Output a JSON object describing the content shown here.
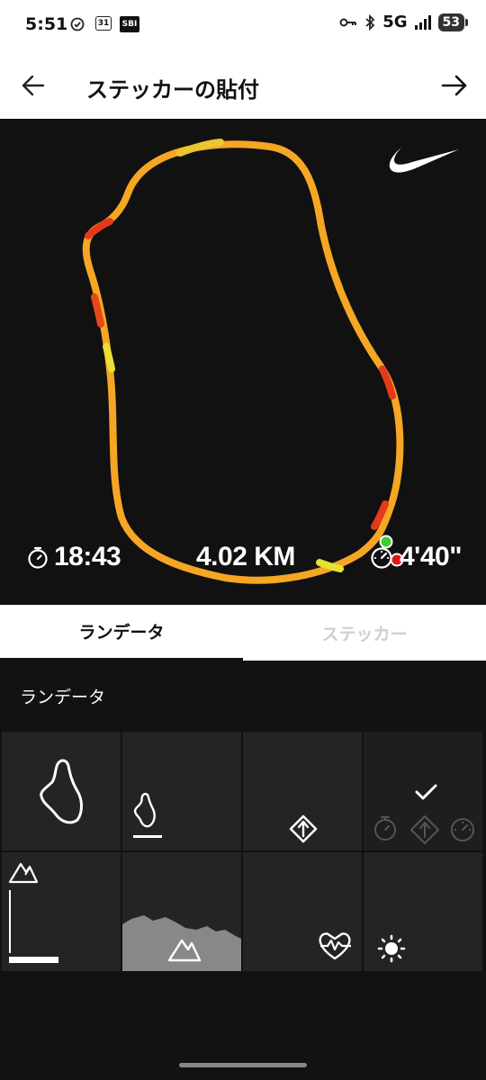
{
  "status_bar": {
    "time": "5:51",
    "calendar_day": "31",
    "sbi_label": "SBI",
    "network": "5G",
    "battery": "53"
  },
  "header": {
    "title": "ステッカーの貼付"
  },
  "preview": {
    "brand_icon": "nike-swoosh-icon",
    "route_colors": {
      "main": "#f5a623",
      "fast": "#e53a1a",
      "slow": "#e8e032"
    },
    "duration": "18:43",
    "distance": "4.02 KM",
    "pace": "4'40\""
  },
  "tabs": [
    {
      "label": "ランデータ",
      "active": true
    },
    {
      "label": "ステッカー",
      "active": false
    }
  ],
  "section": {
    "title": "ランデータ"
  },
  "sticker_options": [
    {
      "icon": "route-outline-icon"
    },
    {
      "icon": "route-small-with-bar-icon"
    },
    {
      "icon": "direction-diamond-icon"
    },
    {
      "icon": "run-stats-icons",
      "selected": true
    },
    {
      "icon": "elevation-axis-icon"
    },
    {
      "icon": "elevation-profile-icon"
    },
    {
      "icon": "heart-rate-icon"
    },
    {
      "icon": "weather-sun-icon"
    }
  ]
}
